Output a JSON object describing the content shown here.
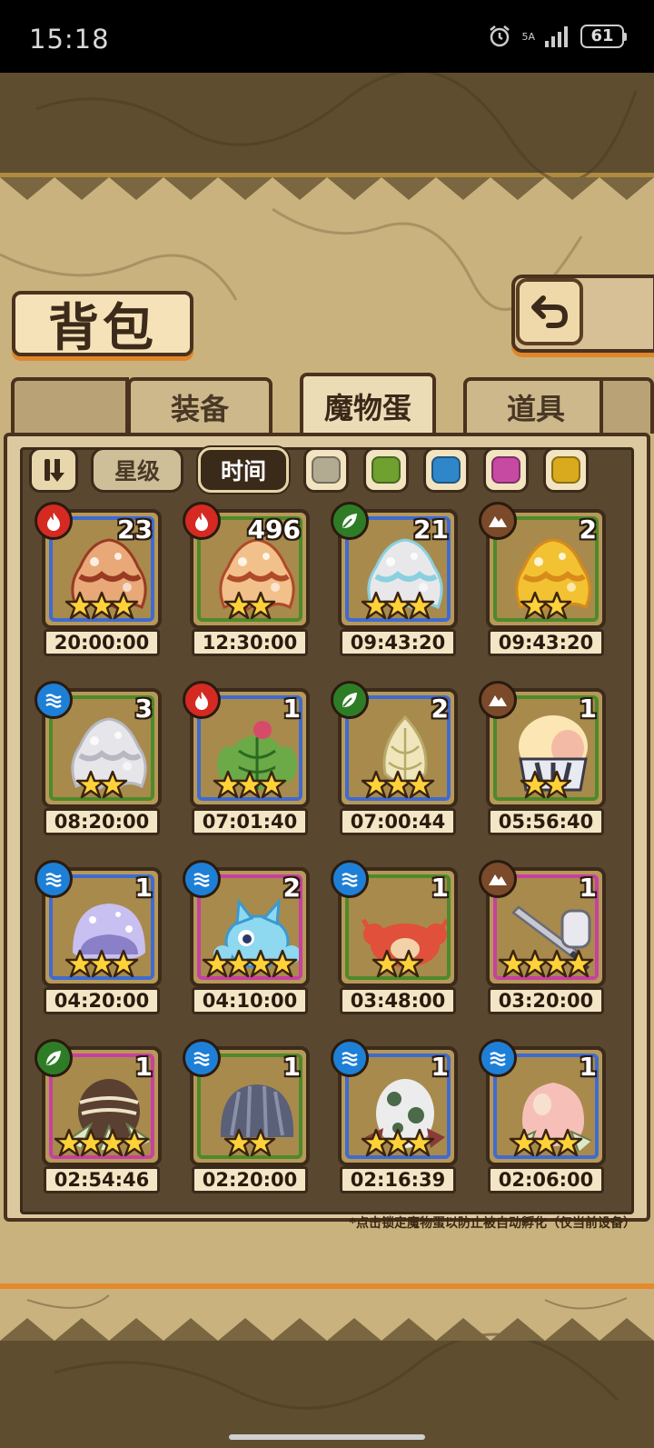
{
  "status": {
    "time": "15:18",
    "network": "5A",
    "battery": "61"
  },
  "page": {
    "title": "背包"
  },
  "tabs": [
    {
      "label": "装备",
      "active": false
    },
    {
      "label": "魔物蛋",
      "active": true
    },
    {
      "label": "道具",
      "active": false
    }
  ],
  "filters": {
    "star_label": "星级",
    "time_label": "时间",
    "active": "时间",
    "colors": [
      "#b3aa92",
      "#6fa030",
      "#2f87c9",
      "#c64aa2",
      "#d9aa1e"
    ]
  },
  "elements": {
    "fire": "#d42a22",
    "leaf": "#2e7d26",
    "earth": "#7a4a2a",
    "water": "#1e7fd6"
  },
  "frames": {
    "blue": "#3f6bd0",
    "green": "#4e8a2a",
    "pink": "#c840a0"
  },
  "eggs": [
    {
      "count": "23",
      "element": "fire",
      "frame": "blue",
      "stars": 3,
      "timer": "20:00:00",
      "monster": "brown-egg",
      "c1": "#e8a878",
      "c2": "#9a3a22"
    },
    {
      "count": "496",
      "element": "fire",
      "frame": "green",
      "stars": 2,
      "timer": "12:30:00",
      "monster": "brown-egg",
      "c1": "#f2c08a",
      "c2": "#b04a2a"
    },
    {
      "count": "21",
      "element": "leaf",
      "frame": "blue",
      "stars": 3,
      "timer": "09:43:20",
      "monster": "white-egg",
      "c1": "#e8e8ea",
      "c2": "#8ad0e0"
    },
    {
      "count": "2",
      "element": "earth",
      "frame": "green",
      "stars": 2,
      "timer": "09:43:20",
      "monster": "yellow-egg",
      "c1": "#f2c232",
      "c2": "#d88a1a"
    },
    {
      "count": "3",
      "element": "water",
      "frame": "green",
      "stars": 2,
      "timer": "08:20:00",
      "monster": "white-egg",
      "c1": "#e6e6ea",
      "c2": "#b8b8c2"
    },
    {
      "count": "1",
      "element": "fire",
      "frame": "blue",
      "stars": 3,
      "timer": "07:01:40",
      "monster": "cactus",
      "c1": "#6caa48",
      "c2": "#2a6a22"
    },
    {
      "count": "2",
      "element": "leaf",
      "frame": "blue",
      "stars": 3,
      "timer": "07:00:44",
      "monster": "bud",
      "c1": "#f0e6bc",
      "c2": "#b8aa6a"
    },
    {
      "count": "1",
      "element": "earth",
      "frame": "green",
      "stars": 2,
      "timer": "05:56:40",
      "monster": "capsule",
      "c1": "#fbe6b4",
      "c2": "#f0a8a0"
    },
    {
      "count": "1",
      "element": "water",
      "frame": "blue",
      "stars": 3,
      "timer": "04:20:00",
      "monster": "jelly",
      "c1": "#c8c0f0",
      "c2": "#8a80c8"
    },
    {
      "count": "2",
      "element": "water",
      "frame": "pink",
      "stars": 4,
      "timer": "04:10:00",
      "monster": "water-cat",
      "c1": "#8ed8f0",
      "c2": "#3a9ad0"
    },
    {
      "count": "1",
      "element": "water",
      "frame": "green",
      "stars": 2,
      "timer": "03:48:00",
      "monster": "crab",
      "c1": "#e0503a",
      "c2": "#f2d2a8"
    },
    {
      "count": "1",
      "element": "earth",
      "frame": "pink",
      "stars": 4,
      "timer": "03:20:00",
      "monster": "sword",
      "c1": "#c8c8d0",
      "c2": "#6a6a78"
    },
    {
      "count": "1",
      "element": "leaf",
      "frame": "pink",
      "stars": 4,
      "timer": "02:54:46",
      "monster": "coconut",
      "c1": "#5a4030",
      "c2": "#eee2c8"
    },
    {
      "count": "1",
      "element": "water",
      "frame": "green",
      "stars": 2,
      "timer": "02:20:00",
      "monster": "shell",
      "c1": "#5a6078",
      "c2": "#8a90a8"
    },
    {
      "count": "1",
      "element": "water",
      "frame": "blue",
      "stars": 3,
      "timer": "02:16:39",
      "monster": "spotted-egg",
      "c1": "#ececec",
      "c2": "#4a6a4a"
    },
    {
      "count": "1",
      "element": "water",
      "frame": "blue",
      "stars": 3,
      "timer": "02:06:00",
      "monster": "peach",
      "c1": "#f6c0b8",
      "c2": "#f8e0d0"
    }
  ],
  "footnote": "*点击锁定魔物蛋以防止被自动孵化（仅当前设备）"
}
